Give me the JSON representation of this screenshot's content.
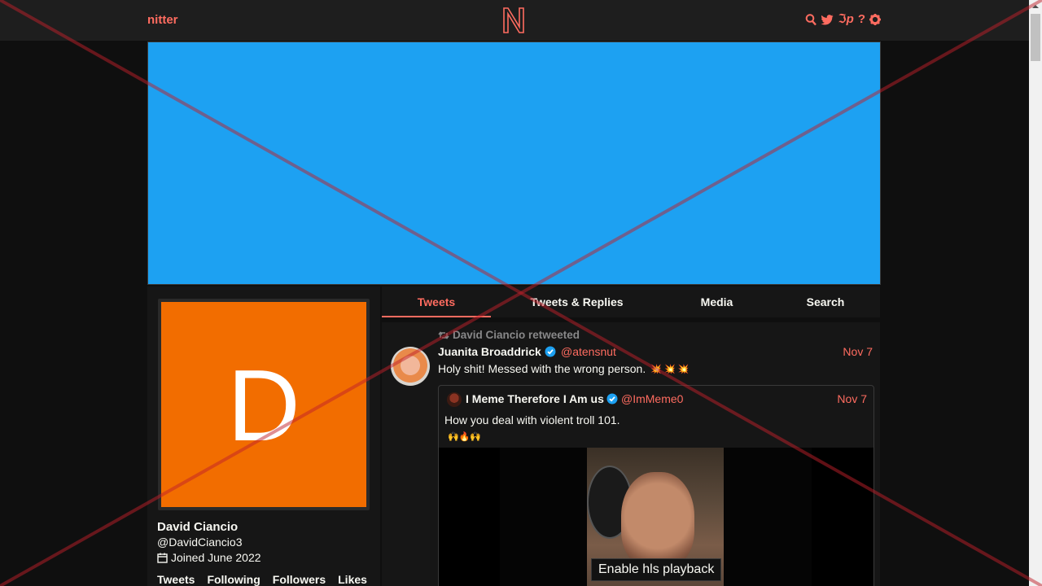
{
  "navbar": {
    "brand": "nitter",
    "icons": [
      "search-icon",
      "twitter-icon",
      "rss-icon",
      "help-icon",
      "settings-icon"
    ],
    "rss_text": "ℑp",
    "help_text": "?"
  },
  "colors": {
    "accent": "#ff6c60",
    "banner": "#1da1f2",
    "avatar_bg": "#f26d00",
    "background": "#0f0f0f",
    "panel": "#161616",
    "verified": "#1da1f2"
  },
  "profile": {
    "avatar_letter": "D",
    "fullname": "David Ciancio",
    "username": "@DavidCiancio3",
    "joined": "Joined June 2022",
    "stats": [
      "Tweets",
      "Following",
      "Followers",
      "Likes"
    ]
  },
  "tabs": [
    {
      "label": "Tweets",
      "active": true
    },
    {
      "label": "Tweets & Replies",
      "active": false
    },
    {
      "label": "Media",
      "active": false
    },
    {
      "label": "Search",
      "active": false
    }
  ],
  "tweet": {
    "retweet_header": "David Ciancio retweeted",
    "fullname": "Juanita Broaddrick",
    "username": "@atensnut",
    "date": "Nov 7",
    "text": "Holy shit!  Messed with the wrong person.",
    "text_emojis": "💥 💥 💥",
    "quote": {
      "fullname": "I Meme Therefore I Am us",
      "username": "@ImMeme0",
      "date": "Nov 7",
      "text": "How you deal with violent troll 101.",
      "emojis": "🙌🔥🙌",
      "video_button": "Enable hls playback"
    }
  }
}
